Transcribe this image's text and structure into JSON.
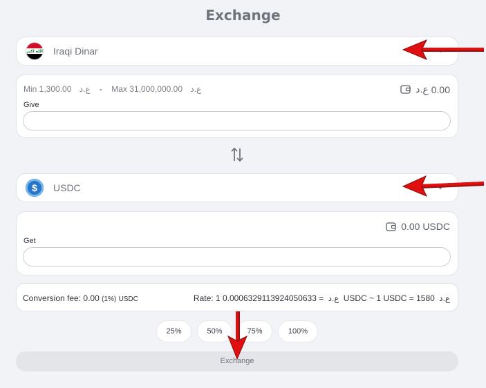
{
  "page": {
    "title": "Exchange"
  },
  "from_currency": {
    "name": "Iraqi Dinar",
    "flag_emblem": "الله اكبر"
  },
  "give_card": {
    "min": "Min 1,300.00",
    "max": "Max 31,000,000.00",
    "currency_symbol": "ع.د",
    "separator": "-",
    "balance": "0.00",
    "label": "Give",
    "input_value": ""
  },
  "to_currency": {
    "name": "USDC",
    "coin_symbol": "$"
  },
  "get_card": {
    "balance": "0.00 USDC",
    "label": "Get",
    "input_value": ""
  },
  "fee": {
    "label": "Conversion fee:",
    "amount": "0.00",
    "percent": "(1%)",
    "unit": "USDC"
  },
  "rate": {
    "prefix": "Rate: 1",
    "symbol": "ع.د",
    "value": "= 0.00063291139240506 33 USDC ~ 1 USDC = 1580",
    "text_a": "= 0.0006329113924050633 USDC ~ 1 USDC = 1580",
    "symbol2": "ع.د"
  },
  "percent_buttons": [
    "25%",
    "50%",
    "75%",
    "100%"
  ],
  "exchange_button": {
    "label": "Exchange"
  },
  "colors": {
    "arrow": "#e01010",
    "usdc": "#2775ca",
    "flag_red": "#ce1126",
    "flag_black": "#000000"
  },
  "icons": {
    "chevron": "chevron-down-icon",
    "wallet": "wallet-icon",
    "swap": "swap-arrows-icon"
  }
}
